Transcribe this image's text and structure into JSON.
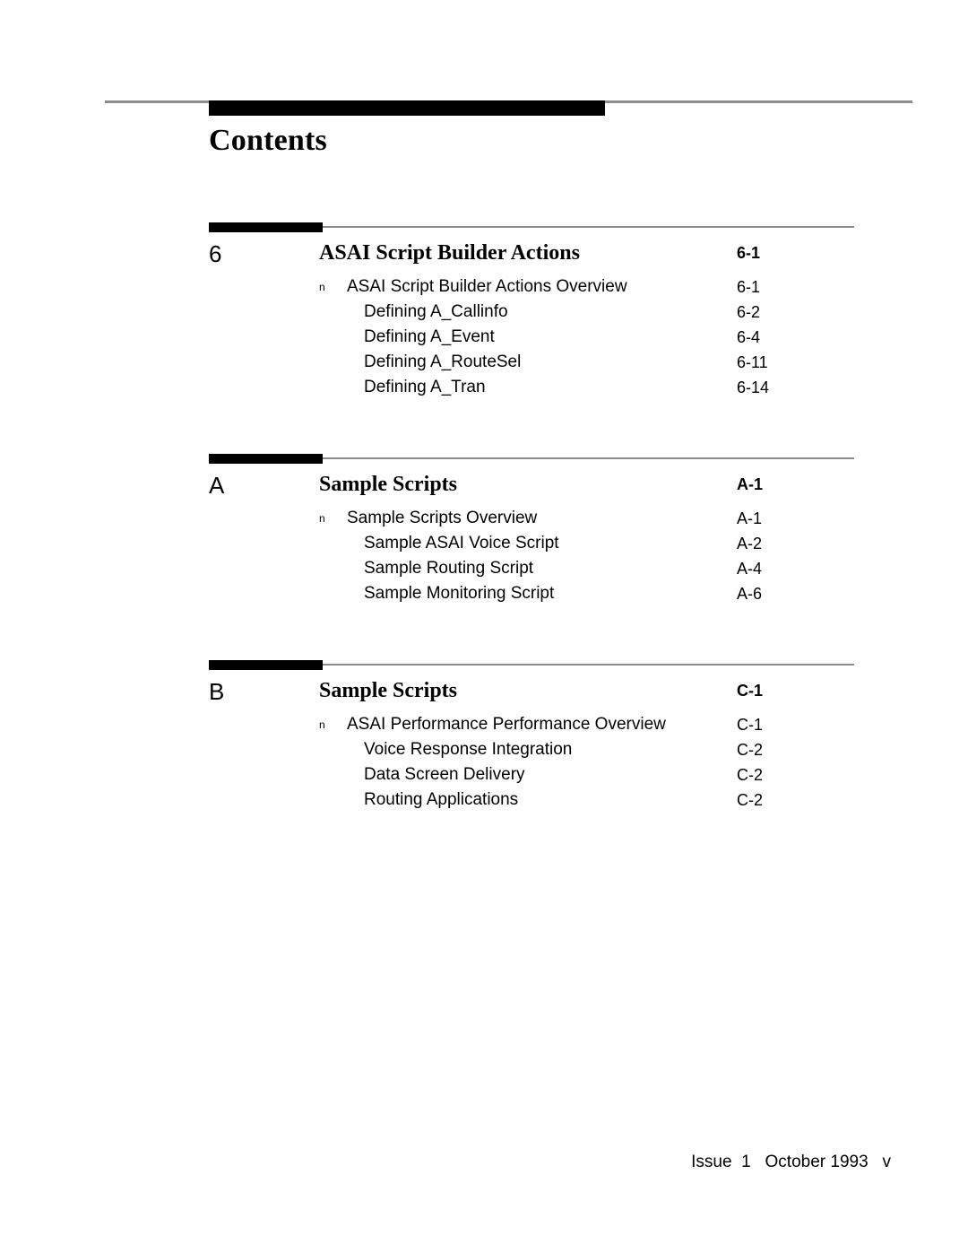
{
  "header": {
    "title": "Contents"
  },
  "footer": {
    "text": "Issue  1   October 1993   v"
  },
  "bullet_glyph": "n",
  "sections": [
    {
      "number": "6",
      "title": "ASAI Script Builder Actions",
      "page": "6-1",
      "entries": [
        {
          "level": 1,
          "bullet": true,
          "label": "ASAI Script Builder Actions Overview",
          "page": "6-1"
        },
        {
          "level": 2,
          "bullet": false,
          "label": "Defining A_Callinfo",
          "page": "6-2"
        },
        {
          "level": 2,
          "bullet": false,
          "label": "Defining A_Event",
          "page": "6-4"
        },
        {
          "level": 2,
          "bullet": false,
          "label": "Defining A_RouteSel",
          "page": "6-11"
        },
        {
          "level": 2,
          "bullet": false,
          "label": "Defining A_Tran",
          "page": "6-14"
        }
      ]
    },
    {
      "number": "A",
      "title": "Sample Scripts",
      "page": "A-1",
      "entries": [
        {
          "level": 1,
          "bullet": true,
          "label": "Sample Scripts Overview",
          "page": "A-1"
        },
        {
          "level": 2,
          "bullet": false,
          "label": "Sample ASAI Voice Script",
          "page": "A-2"
        },
        {
          "level": 2,
          "bullet": false,
          "label": "Sample Routing Script",
          "page": "A-4"
        },
        {
          "level": 2,
          "bullet": false,
          "label": "Sample Monitoring Script",
          "page": "A-6"
        }
      ]
    },
    {
      "number": "B",
      "title": "Sample Scripts",
      "page": "C-1",
      "entries": [
        {
          "level": 1,
          "bullet": true,
          "label": "ASAI Performance Performance Overview",
          "page": "C-1"
        },
        {
          "level": 2,
          "bullet": false,
          "label": "Voice Response Integration",
          "page": "C-2"
        },
        {
          "level": 2,
          "bullet": false,
          "label": "Data Screen Delivery",
          "page": "C-2"
        },
        {
          "level": 2,
          "bullet": false,
          "label": "Routing Applications",
          "page": "C-2"
        }
      ]
    }
  ],
  "colors": {
    "rule": "#8c8c8c",
    "bar": "#000000",
    "text": "#000000"
  }
}
